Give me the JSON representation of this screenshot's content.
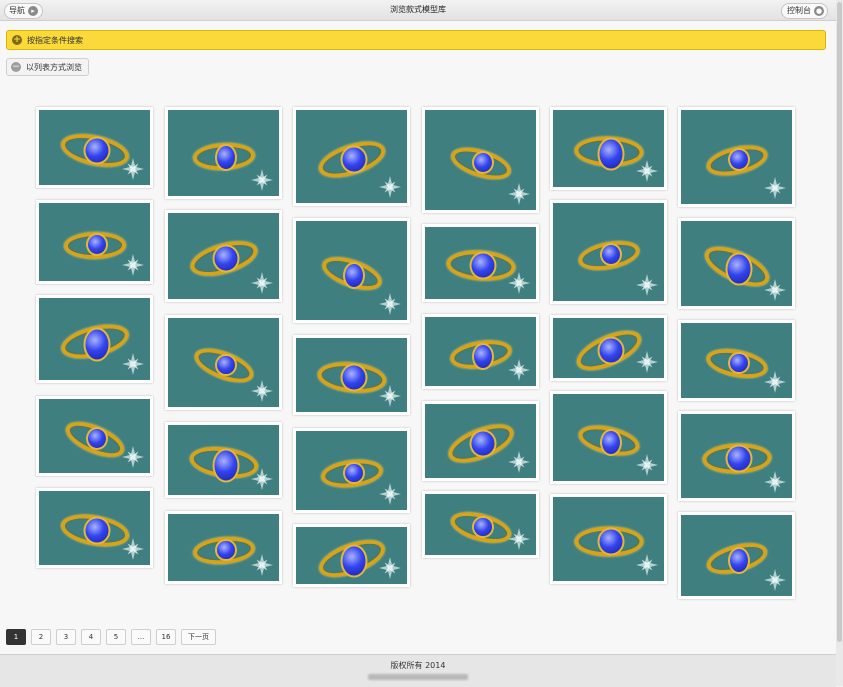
{
  "topbar": {
    "nav_label": "导航",
    "title": "浏览款式模型库",
    "control_label": "控制台"
  },
  "search": {
    "label": "按指定条件搜索"
  },
  "view_toggle": {
    "label": "以列表方式浏览"
  },
  "colors": {
    "card_background": "#3f7f7f",
    "search_bar": "#fbd93a",
    "gem": "#3344ee",
    "gold": "#d6a41c"
  },
  "gallery": {
    "item_icon": "ring-render-image",
    "watermark_icon": "compass-star-logo-icon",
    "columns": 6,
    "rows": 5
  },
  "pagination": {
    "pages": [
      "1",
      "2",
      "3",
      "4",
      "5",
      "...",
      "16"
    ],
    "current": "1",
    "next_label": "下一页"
  },
  "footer": {
    "copyright": "版权所有 2014"
  }
}
